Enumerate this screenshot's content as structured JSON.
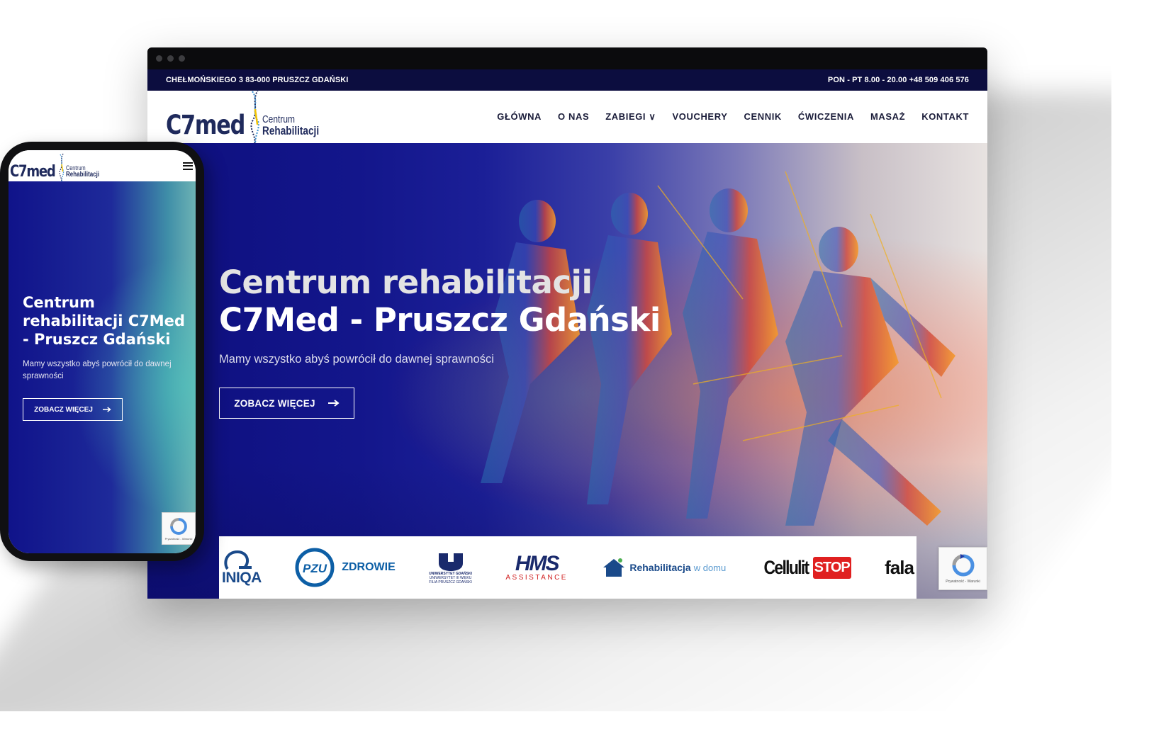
{
  "browser": {
    "infobar": {
      "address": "CHEŁMOŃSKIEGO 3 83-000 PRUSZCZ GDAŃSKI",
      "hours_phone": "PON - PT 8.00 - 20.00 +48 509 406 576"
    },
    "logo": {
      "main": "C7med",
      "sub1": "Centrum",
      "sub2": "Rehabilitacji"
    },
    "menu": [
      {
        "label": "GŁÓWNA"
      },
      {
        "label": "O NAS"
      },
      {
        "label": "ZABIEGI ∨"
      },
      {
        "label": "VOUCHERY"
      },
      {
        "label": "CENNIK"
      },
      {
        "label": "ĆWICZENIA"
      },
      {
        "label": "MASAŻ"
      },
      {
        "label": "KONTAKT"
      }
    ],
    "hero": {
      "title_line1": "Centrum rehabilitacji",
      "title_line2": "C7Med - Pruszcz Gdański",
      "subtitle": "Mamy wszystko abyś powrócił do dawnej sprawności",
      "button": "ZOBACZ WIĘCEJ",
      "button_icon": "arrow-right-icon"
    },
    "partners": [
      {
        "name": "INIQA"
      },
      {
        "name": "PZU",
        "label": "ZDROWIE"
      },
      {
        "name": "UNIWERSYTET GDAŃSKI",
        "lines": [
          "UNIWERSYTET GDAŃSKI",
          "UNIWERSYTET III WIEKU",
          "FILIA PRUSZCZ GDAŃSKI"
        ]
      },
      {
        "name": "HMS",
        "label": "ASSISTANCE"
      },
      {
        "name": "Rehabilitacja",
        "label": "w domu"
      },
      {
        "name": "Cellulit",
        "label": "STOP"
      },
      {
        "name": "fala"
      }
    ],
    "recaptcha": {
      "links": "Prywatność - Warunki"
    }
  },
  "phone": {
    "logo": {
      "main": "C7med",
      "sub1": "Centrum",
      "sub2": "Rehabilitacji"
    },
    "hero": {
      "title": "Centrum rehabilitacji C7Med - Pruszcz Gdański",
      "subtitle": "Mamy wszystko abyś powrócił do dawnej sprawności",
      "button": "ZOBACZ WIĘCEJ"
    },
    "recaptcha": {
      "links": "Prywatność - Warunki"
    }
  },
  "colors": {
    "infobar_bg": "#0c0d3f",
    "hero_blue": "#13168b",
    "logo_navy": "#1f2a5c",
    "pzu_blue": "#0d5fa6",
    "hms_navy": "#1a2a6c",
    "cellulit_red": "#e02020"
  }
}
